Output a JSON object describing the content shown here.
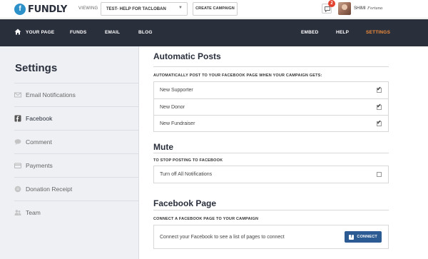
{
  "topbar": {
    "logo": "FUNDLY",
    "logo_mark": "f",
    "viewing_label": "VIEWING",
    "campaign_select": "TEST- HELP FOR TACLOBAN",
    "create_campaign": "CREATE CAMPAIGN",
    "messages_badge": "2",
    "user_first": "SHIMI",
    "user_last": "Fortuna"
  },
  "nav": {
    "left": [
      "YOUR PAGE",
      "FUNDS",
      "EMAIL",
      "BLOG"
    ],
    "right": [
      "EMBED",
      "HELP",
      "SETTINGS"
    ],
    "active": "SETTINGS",
    "active_color": "#f08c3a",
    "bg_color": "#2a2f3c"
  },
  "sidebar": {
    "title": "Settings",
    "items": [
      {
        "label": "Email Notifications",
        "icon": "envelope-icon"
      },
      {
        "label": "Facebook",
        "icon": "facebook-icon",
        "active": true
      },
      {
        "label": "Comment",
        "icon": "comment-icon"
      },
      {
        "label": "Payments",
        "icon": "credit-card-icon"
      },
      {
        "label": "Donation Receipt",
        "icon": "receipt-icon"
      },
      {
        "label": "Team",
        "icon": "team-icon"
      }
    ]
  },
  "main": {
    "auto_posts": {
      "title": "Automatic Posts",
      "subtitle": "AUTOMATICALLY POST TO YOUR FACEBOOK PAGE WHEN YOUR CAMPAIGN GETS:",
      "options": [
        {
          "label": "New Supporter",
          "checked": true
        },
        {
          "label": "New Donor",
          "checked": true
        },
        {
          "label": "New Fundraiser",
          "checked": true
        }
      ]
    },
    "mute": {
      "title": "Mute",
      "subtitle": "TO STOP POSTING TO FACEBOOK",
      "options": [
        {
          "label": "Turn off All Notifications",
          "checked": false
        }
      ]
    },
    "facebook_page": {
      "title": "Facebook Page",
      "subtitle": "CONNECT A FACEBOOK PAGE TO YOUR CAMPAIGN",
      "connect_text": "Connect your Facebook to see a list of pages to connect",
      "connect_button": "CONNECT"
    }
  }
}
